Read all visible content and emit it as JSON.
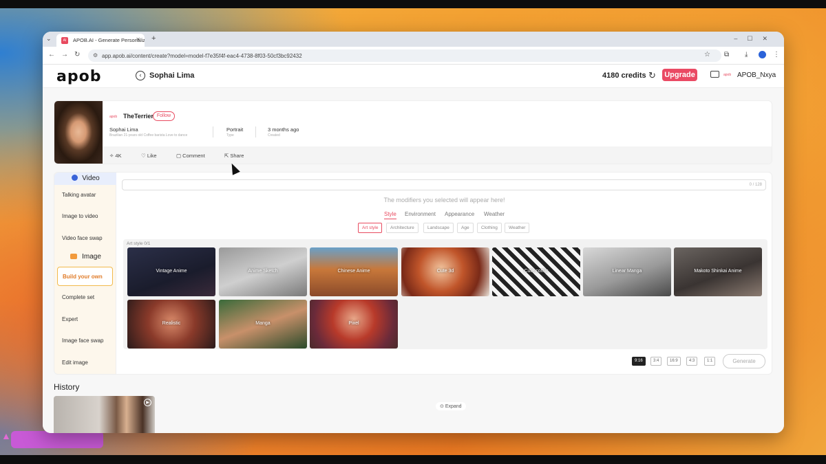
{
  "browser": {
    "tab_title": "APOB.AI - Generate Personalize",
    "url": "app.apob.ai/content/create?model=model-f7e35f4f-eac4-4738-8f03-50cf3bc92432"
  },
  "header": {
    "logo": "apob",
    "model_name": "Sophai Lima",
    "credits": "4180 credits",
    "upgrade_label": "Upgrade",
    "username": "APOB_Nxya"
  },
  "model_card": {
    "owner": "TheTerrier",
    "follow_label": "Follow",
    "name": "Sophai Lima",
    "description": "Brazilian 21-years old Coffee barista Love to dance",
    "type_value": "Portrait",
    "type_label": "Type",
    "created_value": "3 months ago",
    "created_label": "Created",
    "stats": {
      "views": "4K",
      "like": "Like",
      "comment": "Comment",
      "share": "Share"
    }
  },
  "sidebar": {
    "video_header": "Video",
    "video_items": [
      "Talking avatar",
      "Image to video",
      "Video face swap"
    ],
    "image_header": "Image",
    "image_items": [
      "Build your own",
      "Complete set",
      "Expert",
      "Image face swap",
      "Edit image"
    ],
    "active_item": "Build your own"
  },
  "builder": {
    "prompt_count": "0 / 128",
    "modifier_hint": "The modifiers you selected will appear here!",
    "tabs": [
      "Style",
      "Environment",
      "Appearance",
      "Weather"
    ],
    "active_tab": "Style",
    "chips": [
      "Art style",
      "Architecture",
      "Landscape",
      "Age",
      "Clothing",
      "Weather"
    ],
    "active_chip": "Art style",
    "gallery_label": "Art style  0/1",
    "styles": [
      "Vintage Anime",
      "Anime Sketch",
      "Chinese Anime",
      "Cute 3d",
      "Cute comic",
      "Linear Manga",
      "Makoto Shinkai Anime",
      "Realistic",
      "Manga",
      "Pixel"
    ],
    "expand_label": "Expand",
    "ratios": [
      "9:16",
      "3:4",
      "16:9",
      "4:3",
      "1:1"
    ],
    "active_ratio": "9:16",
    "generate_label": "Generate"
  },
  "history": {
    "title": "History"
  },
  "colors": {
    "accent": "#ea4a64",
    "active_orange": "#e07b28",
    "video_blue": "#3a64d8"
  }
}
